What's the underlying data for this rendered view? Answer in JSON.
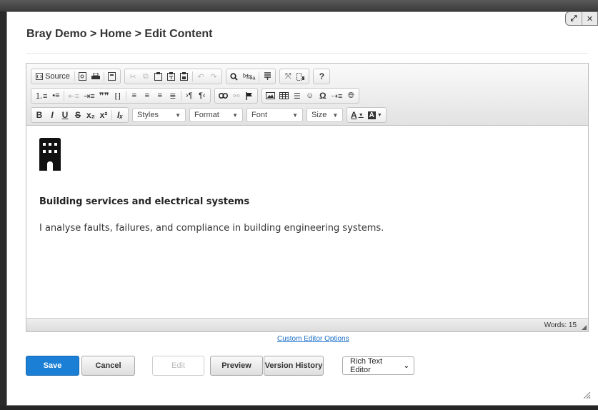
{
  "window": {
    "title": "Bray Demo > Home > Edit Content",
    "controls": {
      "maximize": "⤢",
      "close": "✕"
    }
  },
  "toolbar": {
    "source_label": "Source",
    "combos": {
      "styles": "Styles",
      "format": "Format",
      "font": "Font",
      "size": "Size"
    },
    "format_buttons": {
      "bold": "B",
      "italic": "I",
      "underline": "U",
      "strike": "S",
      "subscript": "x₂",
      "superscript": "x²",
      "remove_format": "Iₓ"
    },
    "misc": {
      "help": "?",
      "text_color": "A",
      "bg_color": "A"
    }
  },
  "content": {
    "icon": "building-icon",
    "heading": "Building services and electrical systems",
    "body": "I analyse faults, failures, and compliance in building engineering systems."
  },
  "status": {
    "word_count": "Words: 15"
  },
  "link": {
    "custom_options": "Custom Editor Options"
  },
  "actions": {
    "save": "Save",
    "cancel": "Cancel",
    "edit": "Edit",
    "preview": "Preview",
    "version_history": "Version History"
  },
  "editor_mode": {
    "selected": "Rich Text Editor"
  },
  "colors": {
    "accent": "#1b7fd6",
    "link": "#1a6fc9"
  }
}
